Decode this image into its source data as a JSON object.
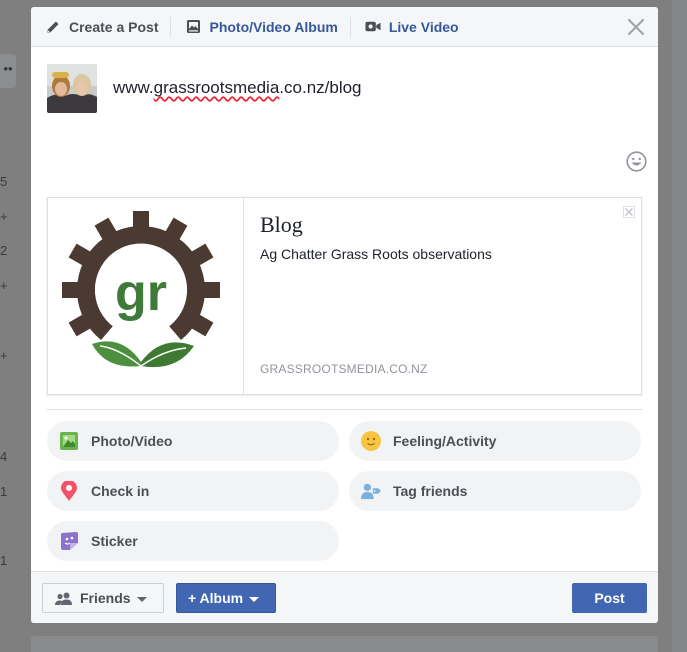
{
  "background": {
    "side_numbers": [
      "5",
      "+",
      "2",
      "+",
      "+",
      "4",
      "1",
      "1"
    ],
    "dots_label": "••"
  },
  "tabs": [
    {
      "label": "Create a Post",
      "icon": "pencil-icon"
    },
    {
      "label": "Photo/Video Album",
      "icon": "album-icon"
    },
    {
      "label": "Live Video",
      "icon": "video-camera-icon"
    }
  ],
  "composer": {
    "text_prefix": "www.",
    "text_spelled": "grassrootsmedia",
    "text_suffix": ".co.nz/blog"
  },
  "link_preview": {
    "title": "Blog",
    "description": "Ag Chatter Grass Roots observations",
    "domain": "GRASSROOTSMEDIA.CO.NZ",
    "logo_text": "gr"
  },
  "actions": [
    {
      "label": "Photo/Video",
      "icon": "photo-icon"
    },
    {
      "label": "Feeling/Activity",
      "icon": "smiley-icon"
    },
    {
      "label": "Check in",
      "icon": "location-pin-icon"
    },
    {
      "label": "Tag friends",
      "icon": "tag-friends-icon"
    },
    {
      "label": "Sticker",
      "icon": "sticker-icon"
    }
  ],
  "footer": {
    "audience_label": "Friends",
    "album_label": "+ Album",
    "post_label": "Post"
  },
  "colors": {
    "brand_blue": "#4267b2",
    "link_blue": "#365899",
    "text_gray": "#4b4f56",
    "logo_brown": "#4a3a31",
    "logo_green": "#3f7a3a"
  }
}
